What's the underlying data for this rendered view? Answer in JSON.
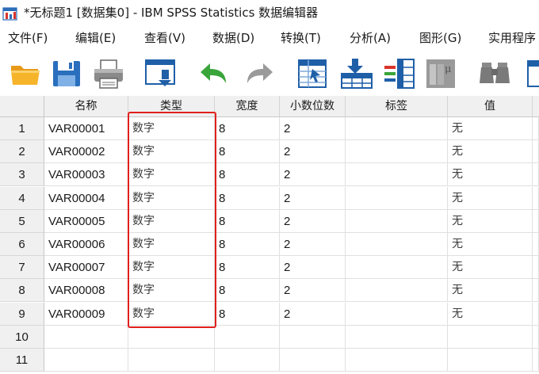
{
  "window": {
    "title": "*无标题1 [数据集0] - IBM SPSS Statistics 数据编辑器"
  },
  "menu": [
    "文件(F)",
    "编辑(E)",
    "查看(V)",
    "数据(D)",
    "转换(T)",
    "分析(A)",
    "图形(G)",
    "实用程序"
  ],
  "toolbar": {
    "buttons": [
      "open-folder-icon",
      "save-icon",
      "print-icon",
      "dialog-recall-icon",
      "undo-icon",
      "redo-icon",
      "go-to-case-icon",
      "insert-cases-icon",
      "insert-variable-icon",
      "split-file-icon",
      "find-icon",
      "variables-icon"
    ]
  },
  "table": {
    "columns": [
      "名称",
      "类型",
      "宽度",
      "小数位数",
      "标签",
      "值"
    ],
    "rows": [
      {
        "num": "1",
        "name": "VAR00001",
        "type": "数字",
        "width": "8",
        "decimals": "2",
        "label": "",
        "values": "无"
      },
      {
        "num": "2",
        "name": "VAR00002",
        "type": "数字",
        "width": "8",
        "decimals": "2",
        "label": "",
        "values": "无"
      },
      {
        "num": "3",
        "name": "VAR00003",
        "type": "数字",
        "width": "8",
        "decimals": "2",
        "label": "",
        "values": "无"
      },
      {
        "num": "4",
        "name": "VAR00004",
        "type": "数字",
        "width": "8",
        "decimals": "2",
        "label": "",
        "values": "无"
      },
      {
        "num": "5",
        "name": "VAR00005",
        "type": "数字",
        "width": "8",
        "decimals": "2",
        "label": "",
        "values": "无"
      },
      {
        "num": "6",
        "name": "VAR00006",
        "type": "数字",
        "width": "8",
        "decimals": "2",
        "label": "",
        "values": "无"
      },
      {
        "num": "7",
        "name": "VAR00007",
        "type": "数字",
        "width": "8",
        "decimals": "2",
        "label": "",
        "values": "无"
      },
      {
        "num": "8",
        "name": "VAR00008",
        "type": "数字",
        "width": "8",
        "decimals": "2",
        "label": "",
        "values": "无"
      },
      {
        "num": "9",
        "name": "VAR00009",
        "type": "数字",
        "width": "8",
        "decimals": "2",
        "label": "",
        "values": "无"
      },
      {
        "num": "10",
        "name": "",
        "type": "",
        "width": "",
        "decimals": "",
        "label": "",
        "values": ""
      },
      {
        "num": "11",
        "name": "",
        "type": "",
        "width": "",
        "decimals": "",
        "label": "",
        "values": ""
      }
    ]
  },
  "colors": {
    "highlight": "#e0201b",
    "header_bg": "#f0f0f0"
  }
}
